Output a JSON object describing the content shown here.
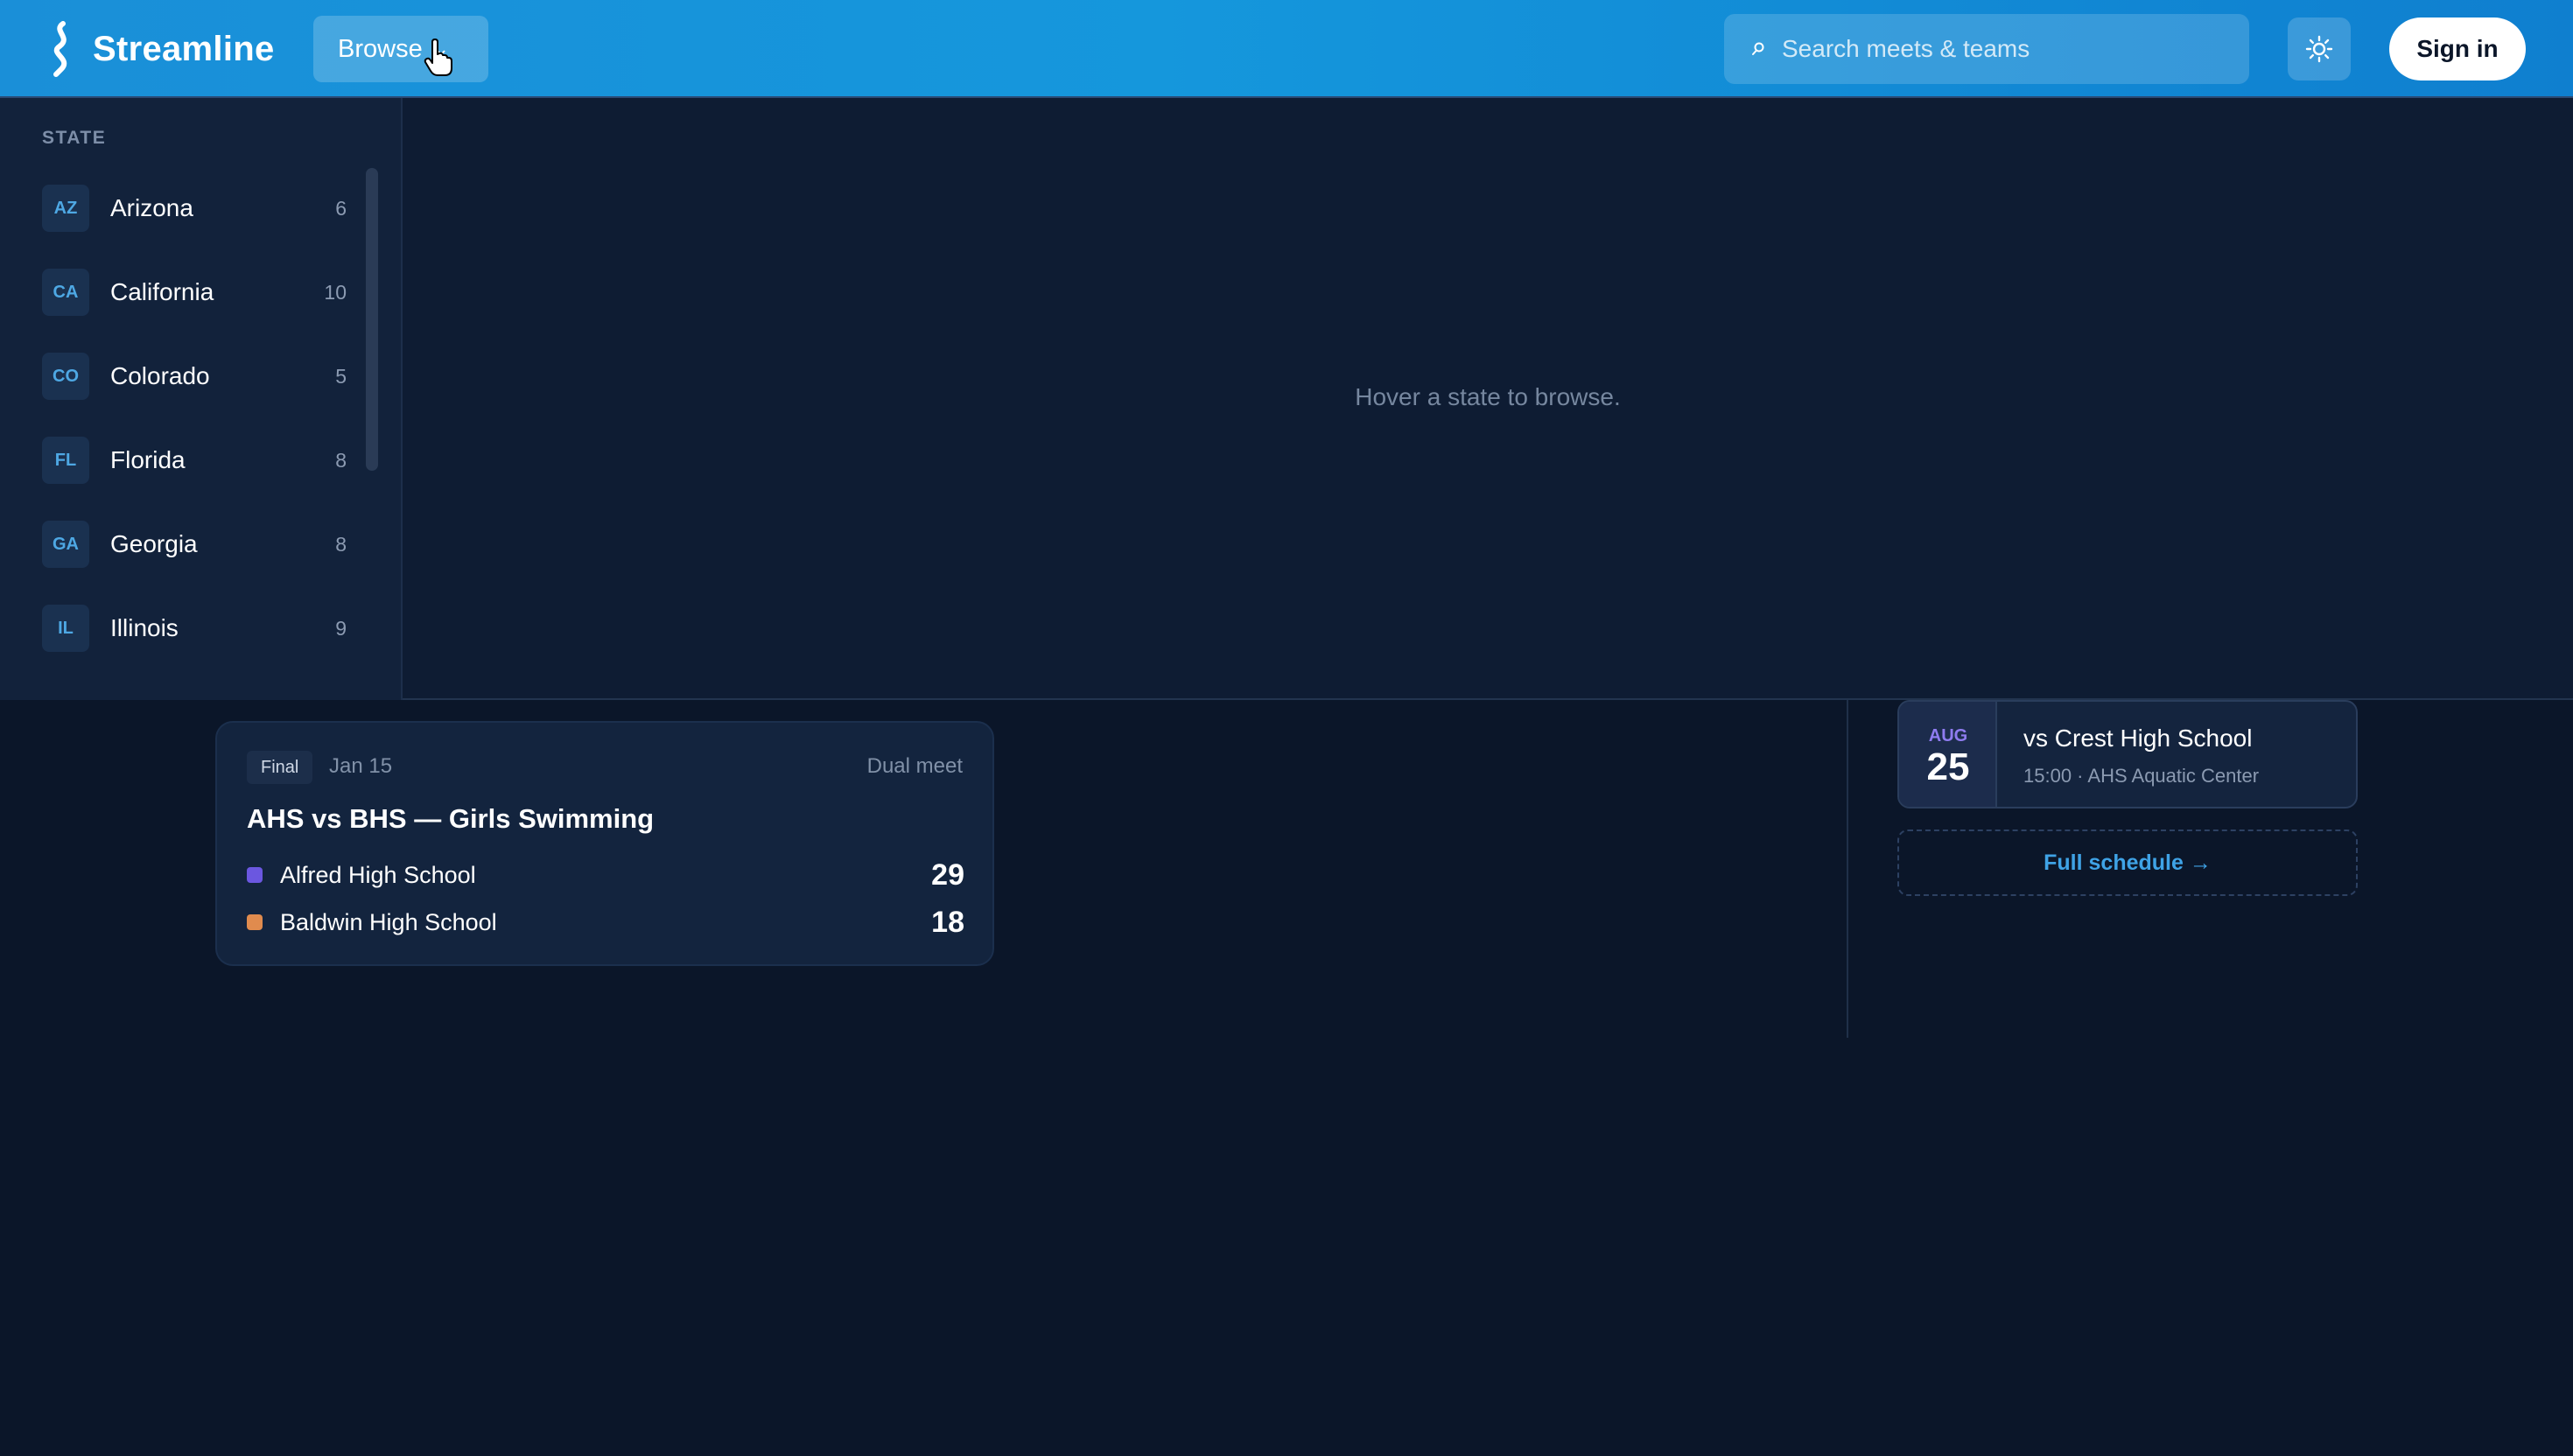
{
  "header": {
    "brand": "Streamline",
    "browse_label": "Browse",
    "search_placeholder": "Search meets & teams",
    "signin_label": "Sign in"
  },
  "browse_panel": {
    "heading": "STATE",
    "states": [
      {
        "abbr": "AZ",
        "name": "Arizona",
        "count": "6"
      },
      {
        "abbr": "CA",
        "name": "California",
        "count": "10"
      },
      {
        "abbr": "CO",
        "name": "Colorado",
        "count": "5"
      },
      {
        "abbr": "FL",
        "name": "Florida",
        "count": "8"
      },
      {
        "abbr": "GA",
        "name": "Georgia",
        "count": "8"
      },
      {
        "abbr": "IL",
        "name": "Illinois",
        "count": "9"
      }
    ],
    "hint": "Hover a state to browse."
  },
  "result": {
    "status": "Final",
    "date": "Jan 15",
    "type": "Dual meet",
    "title": "AHS vs BHS — Girls Swimming",
    "teams": [
      {
        "name": "Alfred High School",
        "score": "29",
        "color": "#6b57e0"
      },
      {
        "name": "Baldwin High School",
        "score": "18",
        "color": "#e08b4e"
      }
    ]
  },
  "upcoming": {
    "month": "AUG",
    "day": "25",
    "title": "vs Crest High School",
    "meta": "15:00 · AHS Aquatic Center",
    "full_schedule_label": "Full schedule →"
  },
  "colors": {
    "header_blue": "#1597dc",
    "background": "#0b1629",
    "accent_blue": "#3fa3e6",
    "accent_purple": "#8f7cf0"
  }
}
